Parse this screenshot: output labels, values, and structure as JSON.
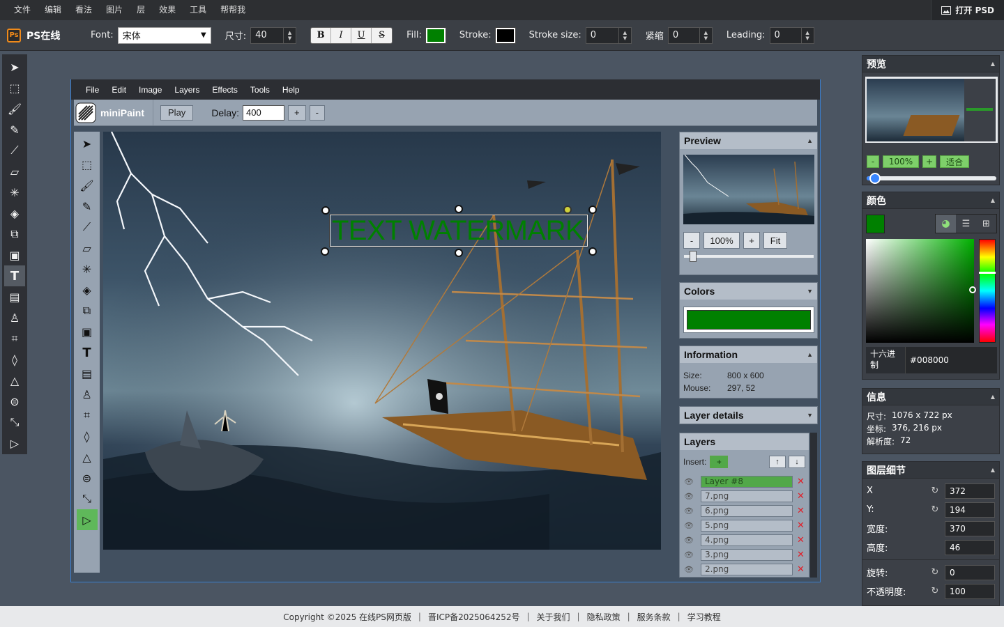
{
  "menubar": {
    "items": [
      "文件",
      "编辑",
      "看法",
      "图片",
      "层",
      "效果",
      "工具",
      "帮帮我"
    ],
    "open_psd": "打开 PSD"
  },
  "optbar": {
    "logo_text": "PS在线",
    "logo_badge": "Ps",
    "font_label": "Font:",
    "font_value": "宋体",
    "size_label": "尺寸:",
    "size_value": "40",
    "bold": "B",
    "italic": "I",
    "underline": "U",
    "strike": "S",
    "fill_label": "Fill:",
    "fill_color": "#008000",
    "stroke_label": "Stroke:",
    "stroke_color": "#000000",
    "stroke_size_label": "Stroke size:",
    "stroke_size_value": "0",
    "kerning_label": "紧缩",
    "kerning_value": "0",
    "leading_label": "Leading:",
    "leading_value": "0"
  },
  "left_tools": [
    "select-arrow-icon",
    "rect-select-icon",
    "brush-icon",
    "pencil-icon",
    "color-picker-icon",
    "eraser-icon",
    "magic-wand-icon",
    "fill-bucket-icon",
    "clone-icon",
    "image-icon",
    "text-icon",
    "gradient-icon",
    "stamp-icon",
    "crop-icon",
    "blur-drop-icon",
    "sharpen-icon",
    "bulge-icon",
    "resize-icon",
    "animation-icon"
  ],
  "right": {
    "preview": {
      "title": "预览",
      "minus": "-",
      "zoom": "100%",
      "plus": "+",
      "fit": "适合",
      "zoom_fraction": 0.08
    },
    "color": {
      "title": "颜色",
      "hex_label": "十六进制",
      "hex_value": "#008000",
      "current": "#008000"
    },
    "info": {
      "title": "信息",
      "size_label": "尺寸:",
      "size_value": "1076 x 722 px",
      "coord_label": "坐标:",
      "coord_value": "376, 216 px",
      "res_label": "解析度:",
      "res_value": "72"
    },
    "layer_details": {
      "title": "图层细节",
      "x_label": "X",
      "x_value": "372",
      "y_label": "Y:",
      "y_value": "194",
      "w_label": "宽度:",
      "w_value": "370",
      "h_label": "高度:",
      "h_value": "46",
      "rot_label": "旋转:",
      "rot_value": "0",
      "opacity_label": "不透明度:",
      "opacity_value": "100"
    }
  },
  "mini": {
    "menu": [
      "File",
      "Edit",
      "Image",
      "Layers",
      "Effects",
      "Tools",
      "Help"
    ],
    "logo": "miniPaint",
    "play": "Play",
    "delay_label": "Delay:",
    "delay_value": "400",
    "plus": "+",
    "minus": "-",
    "watermark": "TEXT WATERMARK",
    "preview": {
      "title": "Preview",
      "minus": "-",
      "zoom": "100%",
      "plus": "+",
      "fit": "Fit"
    },
    "colors": {
      "title": "Colors",
      "color": "#008000"
    },
    "information": {
      "title": "Information",
      "size_label": "Size:",
      "size_value": "800 x 600",
      "mouse_label": "Mouse:",
      "mouse_value": "297, 52"
    },
    "layer_details_title": "Layer details",
    "layers": {
      "title": "Layers",
      "insert_label": "Insert:",
      "insert_btn": "+",
      "up": "↑",
      "down": "↓",
      "items": [
        "Layer #8",
        "7.png",
        "6.png",
        "5.png",
        "4.png",
        "3.png",
        "2.png"
      ]
    }
  },
  "footer": {
    "copyright": "Copyright ©2025 在线PS网页版",
    "icp": "晋ICP备2025064252号",
    "about": "关于我们",
    "privacy": "隐私政策",
    "terms": "服务条款",
    "tutorial": "学习教程",
    "sep": "|"
  }
}
